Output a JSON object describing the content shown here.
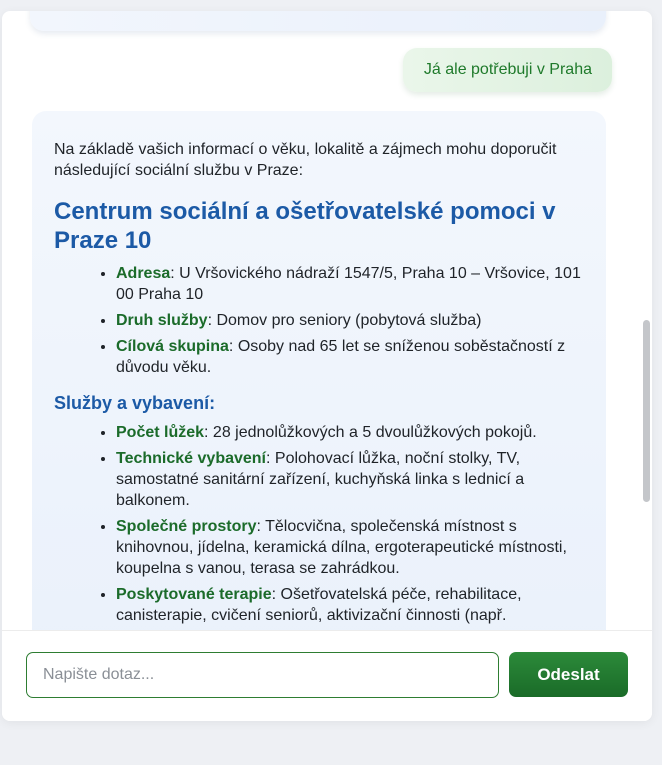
{
  "messages": {
    "user": "Já ale potřebuji v Praha",
    "bot": {
      "intro": "Na základě vašich informací o věku, lokalitě a zájmech mohu doporučit následující sociální službu v Praze:",
      "title": "Centrum sociální a ošetřovatelské pomoci v Praze 10",
      "details": [
        {
          "key": "Adresa",
          "value": ": U Vršovického nádraží 1547/5, Praha 10 – Vršovice, 101 00 Praha 10"
        },
        {
          "key": "Druh služby",
          "value": ": Domov pro seniory (pobytová služba)"
        },
        {
          "key": "Cílová skupina",
          "value": ": Osoby nad 65 let se sníženou soběstačností z důvodu věku."
        }
      ],
      "services_title": "Služby a vybavení:",
      "services": [
        {
          "key": "Počet lůžek",
          "value": ": 28 jednolůžkových a 5 dvoulůžkových pokojů."
        },
        {
          "key": "Technické vybavení",
          "value": ": Polohovací lůžka, noční stolky, TV, samostatné sanitární zařízení, kuchyňská linka s lednicí a balkonem."
        },
        {
          "key": "Společné prostory",
          "value": ": Tělocvična, společenská místnost s knihovnou, jídelna, keramická dílna, ergoterapeutické místnosti, koupelna s vanou, terasa se zahrádkou."
        },
        {
          "key": "Poskytované terapie",
          "value": ": Ošetřovatelská péče, rehabilitace, canisterapie, cvičení seniorů, aktivizační činnosti (např."
        }
      ]
    }
  },
  "composer": {
    "placeholder": "Napište dotaz...",
    "send_label": "Odeslat"
  },
  "colors": {
    "accent_green": "#1b6b2a",
    "heading_blue": "#1c5aa6"
  }
}
